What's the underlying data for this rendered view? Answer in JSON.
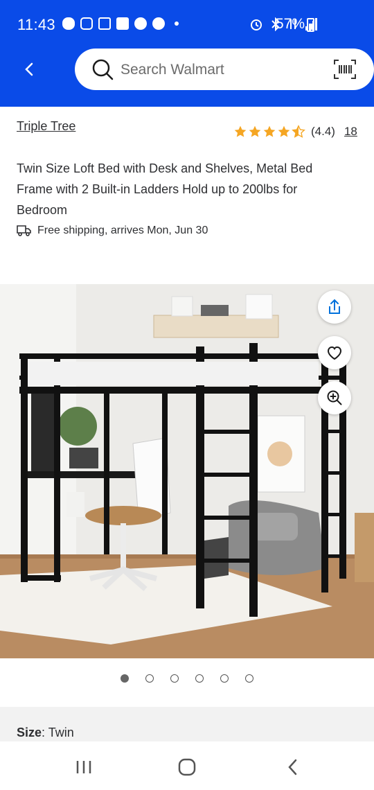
{
  "status_bar": {
    "time": "11:43",
    "battery": "57%"
  },
  "search": {
    "placeholder": "Search Walmart"
  },
  "product": {
    "brand": "Triple Tree",
    "rating_value": "(4.4)",
    "rating_stars": 4.4,
    "review_count": "18",
    "title": "Twin Size Loft Bed with Desk and Shelves, Metal Bed Frame with 2 Built-in Ladders Hold up to 200lbs for Bedroom",
    "shipping": "Free shipping, arrives Mon, Jun 30"
  },
  "carousel": {
    "total": 6,
    "active_index": 0
  },
  "options": {
    "size_label": "Size",
    "size_value": ": Twin"
  },
  "colors": {
    "header_blue": "#0a4be8",
    "star_yellow": "#f5a623",
    "text": "#2e2f32"
  }
}
